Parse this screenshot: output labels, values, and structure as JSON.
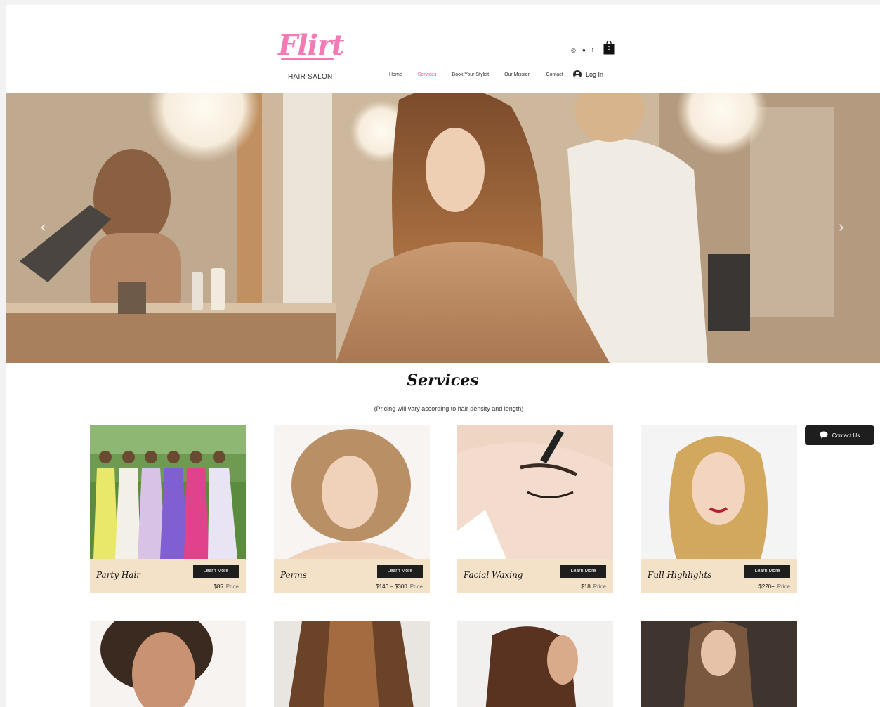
{
  "brand": {
    "name": "Flirt",
    "tagline": "HAIR SALON",
    "color": "#f27bb6"
  },
  "nav": {
    "items": [
      "Home",
      "Services",
      "Book Your Stylist",
      "Our Mission",
      "Contact"
    ],
    "active": "Services",
    "active_color": "#ec4f9b",
    "login_label": "Log In"
  },
  "social": {
    "icons": [
      "instagram-icon",
      "location-pin-icon",
      "facebook-icon"
    ]
  },
  "cart": {
    "count": "0"
  },
  "hero": {
    "prev_icon": "‹",
    "next_icon": "›"
  },
  "services": {
    "title": "Services",
    "subtitle": "(Pricing will vary according to hair density and length)",
    "cards": [
      {
        "name": "Party Hair",
        "button": "Learn More",
        "price": "$85",
        "price_label": "Price"
      },
      {
        "name": "Perms",
        "button": "Learn More",
        "price": "$140 – $300",
        "price_label": "Price"
      },
      {
        "name": "Facial Waxing",
        "button": "Learn More",
        "price": "$18",
        "price_label": "Price"
      },
      {
        "name": "Full Highlights",
        "button": "Learn More",
        "price": "$220+",
        "price_label": "Price"
      }
    ]
  },
  "contact": {
    "label": "Contact Us"
  }
}
